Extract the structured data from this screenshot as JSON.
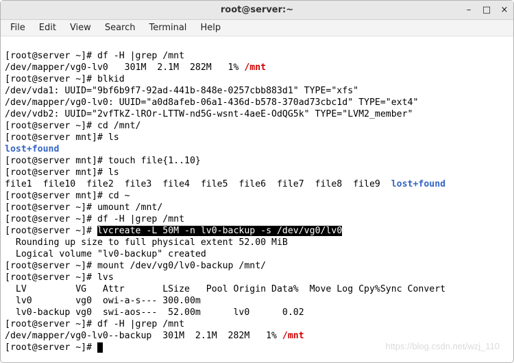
{
  "window": {
    "title": "root@server:~"
  },
  "menus": [
    "File",
    "Edit",
    "View",
    "Search",
    "Terminal",
    "Help"
  ],
  "t": {
    "p_home": "[root@server ~]# ",
    "p_mnt": "[root@server mnt]# ",
    "c01": "df -H |grep /mnt",
    "l02a": "/dev/mapper/vg0-lv0   301M  2.1M  282M   1% ",
    "l02b": "/mnt",
    "c03": "blkid",
    "l04": "/dev/vda1: UUID=\"9bf6b9f7-92ad-441b-848e-0257cbb883d1\" TYPE=\"xfs\"",
    "l05": "/dev/mapper/vg0-lv0: UUID=\"a0d8afeb-06a1-436d-b578-370ad73cbc1d\" TYPE=\"ext4\"",
    "l06": "/dev/vdb2: UUID=\"2vfTkZ-lROr-LTTW-nd5G-wsnt-4aeE-OdQG5k\" TYPE=\"LVM2_member\"",
    "c07": "cd /mnt/",
    "c08": "ls",
    "l09": "lost+found",
    "c10": "touch file{1..10}",
    "c11": "ls",
    "l12a": "file1  file10  file2  file3  file4  file5  file6  file7  file8  file9  ",
    "l12b": "lost+found",
    "c13": "cd ~",
    "c14": "umount /mnt/",
    "c15": "df -H |grep /mnt",
    "c16hl": "lvcreate -L 50M -n lv0-backup -s /dev/vg0/lv0",
    "l17": "  Rounding up size to full physical extent 52.00 MiB",
    "l18": "  Logical volume \"lv0-backup\" created",
    "c19": "mount /dev/vg0/lv0-backup /mnt/",
    "c20": "lvs",
    "l21": "  LV         VG   Attr       LSize   Pool Origin Data%  Move Log Cpy%Sync Convert",
    "l22": "  lv0        vg0  owi-a-s--- 300.00m",
    "l23": "  lv0-backup vg0  swi-aos---  52.00m      lv0      0.02",
    "c24": "df -H |grep /mnt",
    "l25a": "/dev/mapper/vg0-lv0--backup  301M  2.1M  282M   1% ",
    "l25b": "/mnt"
  },
  "watermark": "https://blog.csdn.net/wzj_110"
}
